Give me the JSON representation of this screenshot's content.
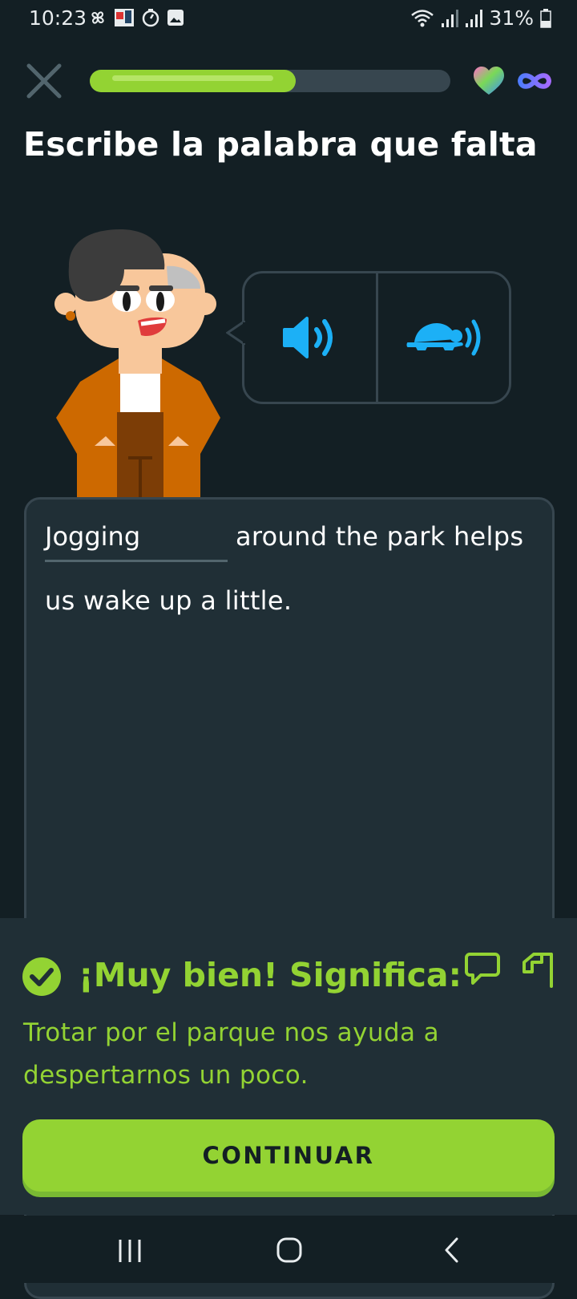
{
  "status_bar": {
    "time": "10:23",
    "battery": "31%"
  },
  "lesson": {
    "progress": 0.57,
    "title": "Escribe la palabra que falta"
  },
  "exercise": {
    "answer_value": "Jogging",
    "line1": "around the park helps",
    "line2": "us wake up a little."
  },
  "feedback": {
    "title": "¡Muy bien! Significa:",
    "translation": "Trotar por el parque nos ayuda a despertarnos un poco."
  },
  "continue_label": "CONTINUAR",
  "colors": {
    "background": "#131f24",
    "accent_green": "#93d333",
    "audio_blue": "#1cb0f6",
    "border": "#37464f"
  },
  "icons": [
    "close-icon",
    "heart-icon",
    "infinity-icon",
    "speaker-icon",
    "turtle-speaker-icon",
    "check-icon",
    "comment-icon",
    "flag-icon",
    "recents-icon",
    "home-icon",
    "back-icon"
  ]
}
